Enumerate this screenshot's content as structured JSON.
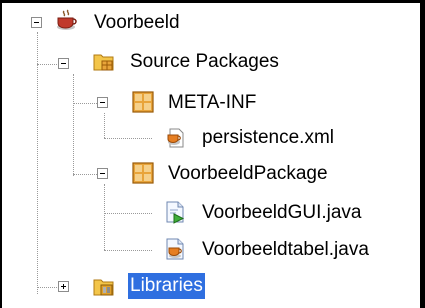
{
  "tree": {
    "project": {
      "label": "Voorbeeld",
      "icon": "coffee-cup-project-icon",
      "expanded": true
    },
    "source_packages": {
      "label": "Source Packages",
      "icon": "source-packages-folder-icon",
      "expanded": true
    },
    "meta_inf": {
      "label": "META-INF",
      "icon": "package-icon",
      "expanded": true
    },
    "persistence_xml": {
      "label": "persistence.xml",
      "icon": "xml-file-icon"
    },
    "voorbeeld_package": {
      "label": "VoorbeeldPackage",
      "icon": "package-icon",
      "expanded": true
    },
    "voorbeeld_gui": {
      "label": "VoorbeeldGUI.java",
      "icon": "java-form-file-icon"
    },
    "voorbeeldtabel": {
      "label": "Voorbeeldtabel.java",
      "icon": "java-class-file-icon"
    },
    "libraries": {
      "label": "Libraries",
      "icon": "libraries-folder-icon",
      "expanded": false,
      "selected": true
    }
  },
  "colors": {
    "selection": "#2f6fe0",
    "package_orange": "#e8a43a",
    "folder_yellow": "#f3c54a"
  }
}
